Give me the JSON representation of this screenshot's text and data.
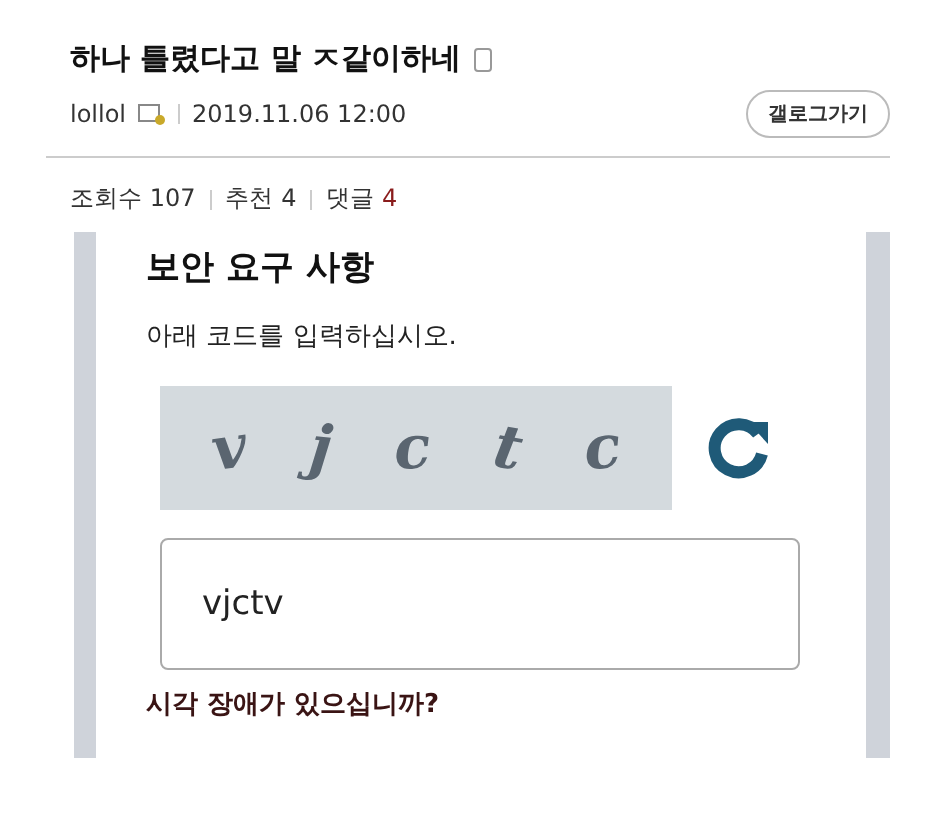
{
  "post": {
    "title": "하나 틀렸다고 말 ㅈ같이하네",
    "author": "lollol",
    "date": "2019.11.06 12:00",
    "gallog_button": "갤로그가기"
  },
  "stats": [
    {
      "label": "조회수",
      "value": "107",
      "kind": "plain"
    },
    {
      "label": "추천",
      "value": "4",
      "kind": "plain"
    },
    {
      "label": "댓글",
      "value": "4",
      "kind": "accent"
    }
  ],
  "captcha_page": {
    "heading": "보안 요구 사항",
    "instruction": "아래 코드를 입력하십시오.",
    "captcha_letters": [
      "v",
      "j",
      "c",
      "t",
      "c"
    ],
    "code_input": {
      "value": "vjctv"
    },
    "accessibility_link": "시각 장애가 있으십니까?"
  }
}
